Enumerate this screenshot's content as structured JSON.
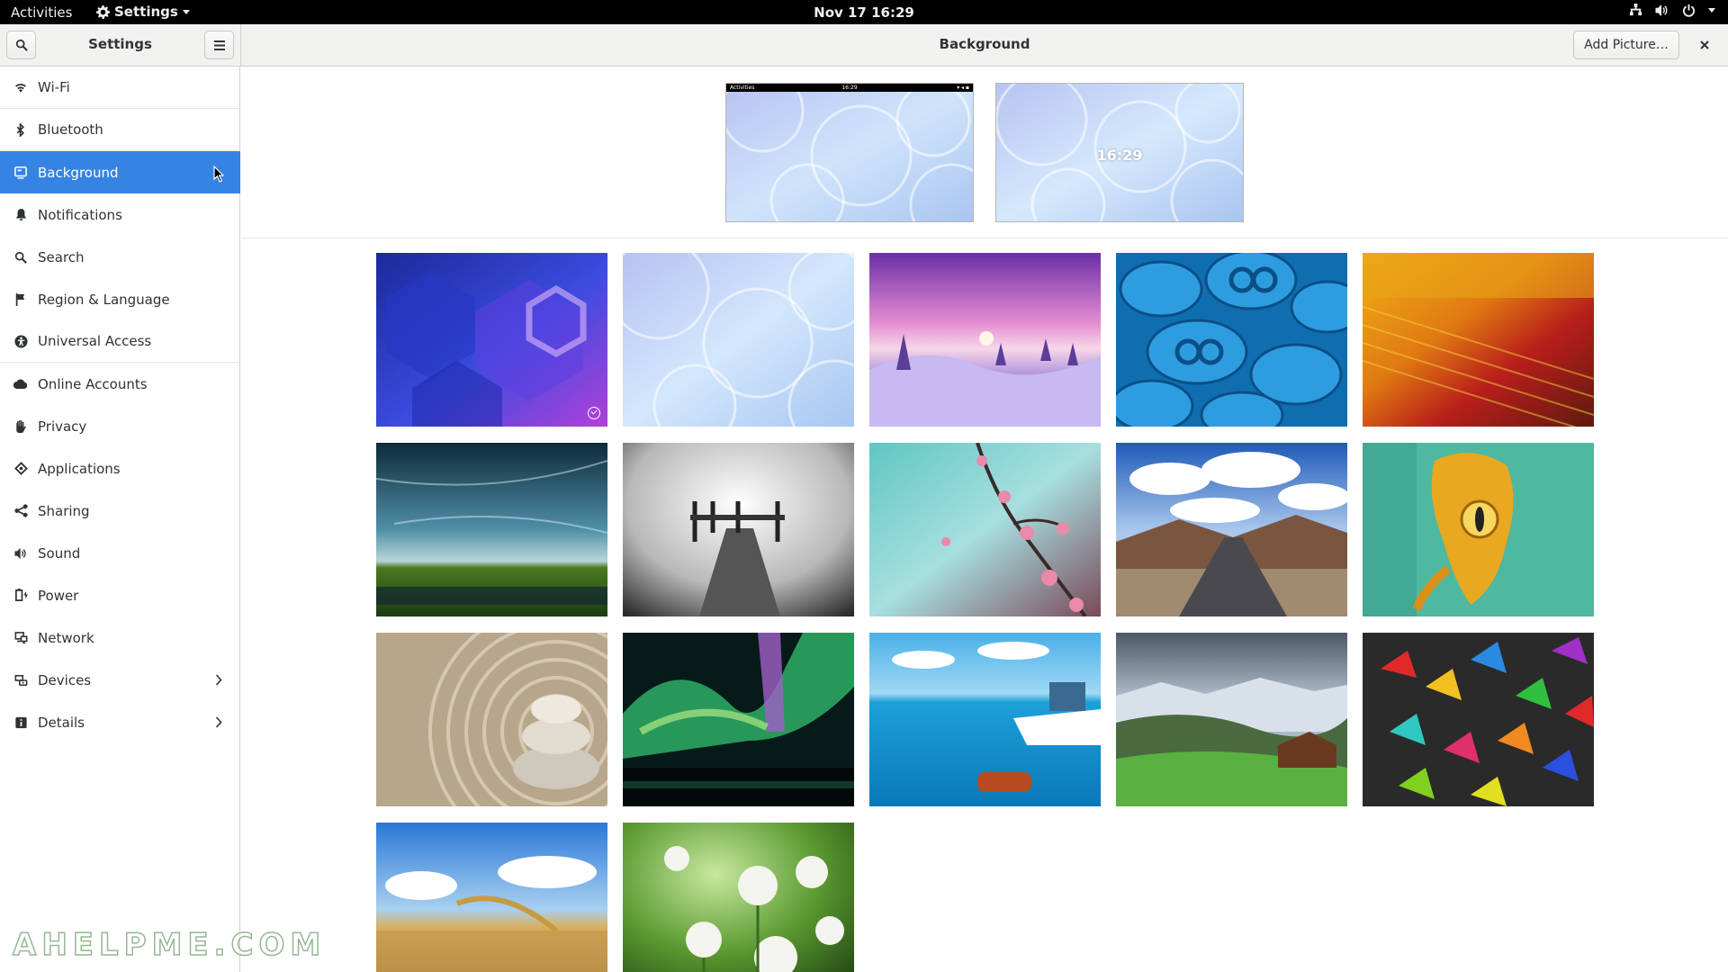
{
  "topbar": {
    "activities": "Activities",
    "app_menu": "Settings",
    "clock": "Nov 17  16:29"
  },
  "headerbar": {
    "sidebar_title": "Settings",
    "page_title": "Background",
    "add_picture": "Add Picture…"
  },
  "sidebar": {
    "items": [
      {
        "label": "Wi-Fi",
        "icon": "wifi-icon"
      },
      {
        "label": "Bluetooth",
        "icon": "bluetooth-icon"
      },
      {
        "label": "Background",
        "icon": "display-icon",
        "selected": true
      },
      {
        "label": "Notifications",
        "icon": "bell-icon"
      },
      {
        "label": "Search",
        "icon": "search-icon"
      },
      {
        "label": "Region & Language",
        "icon": "flag-icon"
      },
      {
        "label": "Universal Access",
        "icon": "accessibility-icon"
      },
      {
        "label": "Online Accounts",
        "icon": "cloud-icon"
      },
      {
        "label": "Privacy",
        "icon": "hand-icon"
      },
      {
        "label": "Applications",
        "icon": "applications-icon"
      },
      {
        "label": "Sharing",
        "icon": "share-icon"
      },
      {
        "label": "Sound",
        "icon": "speaker-icon"
      },
      {
        "label": "Power",
        "icon": "battery-icon"
      },
      {
        "label": "Network",
        "icon": "network-icon"
      },
      {
        "label": "Devices",
        "icon": "devices-icon",
        "has_submenu": true
      },
      {
        "label": "Details",
        "icon": "info-icon",
        "has_submenu": true
      }
    ]
  },
  "previews": {
    "desktop_bar_activities": "Activities",
    "desktop_bar_clock": "16:29",
    "lock_clock": "16:29"
  },
  "wallpapers": [
    {
      "name": "blue-geometric",
      "selected": true
    },
    {
      "name": "frosted-swirl"
    },
    {
      "name": "snowy-sunset"
    },
    {
      "name": "blue-bolts"
    },
    {
      "name": "fabric-macro"
    },
    {
      "name": "sky-meadow"
    },
    {
      "name": "foggy-pier"
    },
    {
      "name": "cherry-blossom"
    },
    {
      "name": "mountain-road"
    },
    {
      "name": "yellow-frog"
    },
    {
      "name": "zen-stones"
    },
    {
      "name": "aurora"
    },
    {
      "name": "boat-sea"
    },
    {
      "name": "alpine-valley"
    },
    {
      "name": "colored-pencils"
    },
    {
      "name": "wheat-sky"
    },
    {
      "name": "dandelions"
    }
  ],
  "watermark": "AHELPME.COM",
  "colors": {
    "accent": "#3584e4",
    "topbar": "#000000",
    "headerbar": "#f1f1f0"
  }
}
